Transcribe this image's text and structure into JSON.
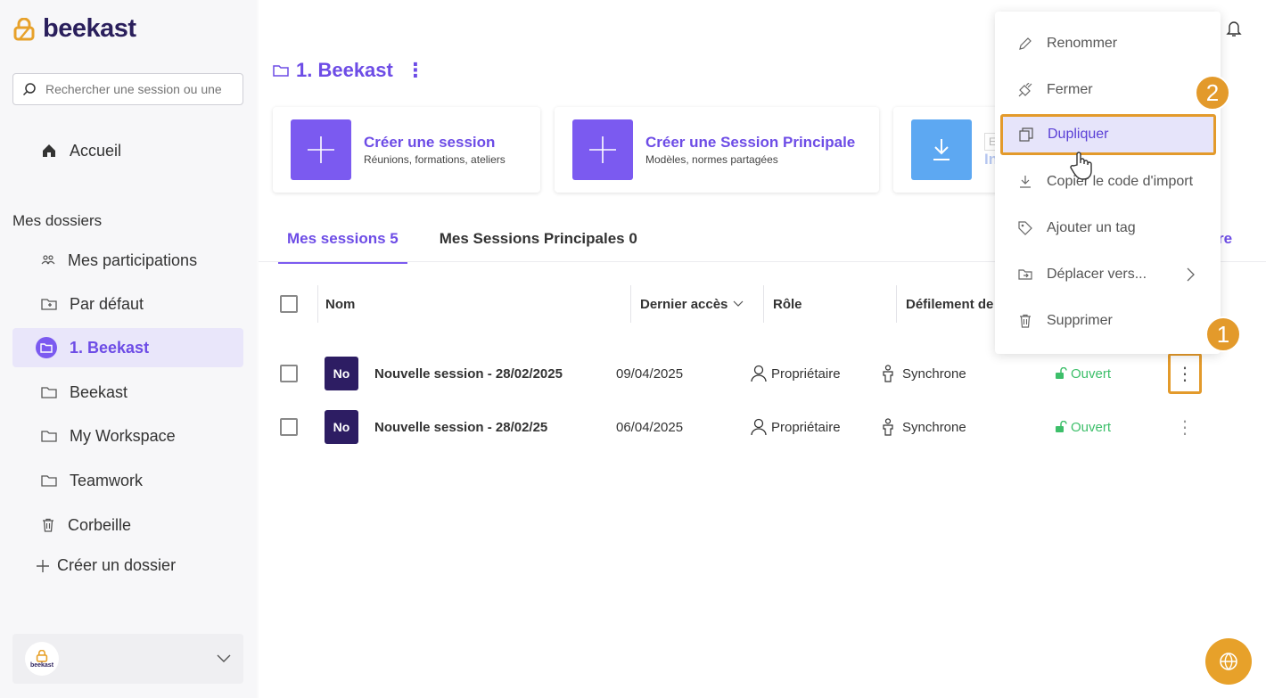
{
  "app": {
    "brand": "beekast",
    "account_brand": "beekast"
  },
  "sidebar": {
    "search_placeholder": "Rechercher une session ou une",
    "home_label": "Accueil",
    "section_title": "Mes dossiers",
    "folders": [
      {
        "label": "Mes participations"
      },
      {
        "label": "Par défaut"
      },
      {
        "label": "1. Beekast"
      },
      {
        "label": "Beekast"
      },
      {
        "label": "My Workspace"
      },
      {
        "label": "Teamwork"
      },
      {
        "label": "Corbeille"
      }
    ],
    "create_folder": "Créer un dossier"
  },
  "main": {
    "breadcrumb": "1. Beekast",
    "cards": [
      {
        "title": "Créer une session",
        "subtitle": "Réunions, formations, ateliers"
      },
      {
        "title": "Créer une Session Principale",
        "subtitle": "Modèles, normes partagées"
      },
      {
        "title": "In",
        "subtitle": "E"
      }
    ],
    "tabs": [
      {
        "label": "Mes sessions 5"
      },
      {
        "label": "Mes Sessions Principales 0"
      }
    ],
    "tab_right_fragment": "re",
    "columns": {
      "name": "Nom",
      "last_access": "Dernier accès",
      "role": "Rôle",
      "scroll": "Défilement de"
    },
    "rows": [
      {
        "badge": "No",
        "name": "Nouvelle session - 28/02/2025",
        "date": "09/04/2025",
        "role": "Propriétaire",
        "mode": "Synchrone",
        "status": "Ouvert"
      },
      {
        "badge": "No",
        "name": "Nouvelle session - 28/02/25",
        "date": "06/04/2025",
        "role": "Propriétaire",
        "mode": "Synchrone",
        "status": "Ouvert"
      }
    ]
  },
  "menu": {
    "items": [
      {
        "label": "Renommer"
      },
      {
        "label": "Fermer"
      },
      {
        "label": "Dupliquer"
      },
      {
        "label": "Copier le code d'import"
      },
      {
        "label": "Ajouter un tag"
      },
      {
        "label": "Déplacer vers..."
      },
      {
        "label": "Supprimer"
      }
    ]
  },
  "steps": {
    "one": "1",
    "two": "2"
  },
  "colors": {
    "accent": "#7b5af0",
    "badge": "#2d1d63",
    "highlight": "#e39a2b",
    "open": "#3dbf6a"
  }
}
